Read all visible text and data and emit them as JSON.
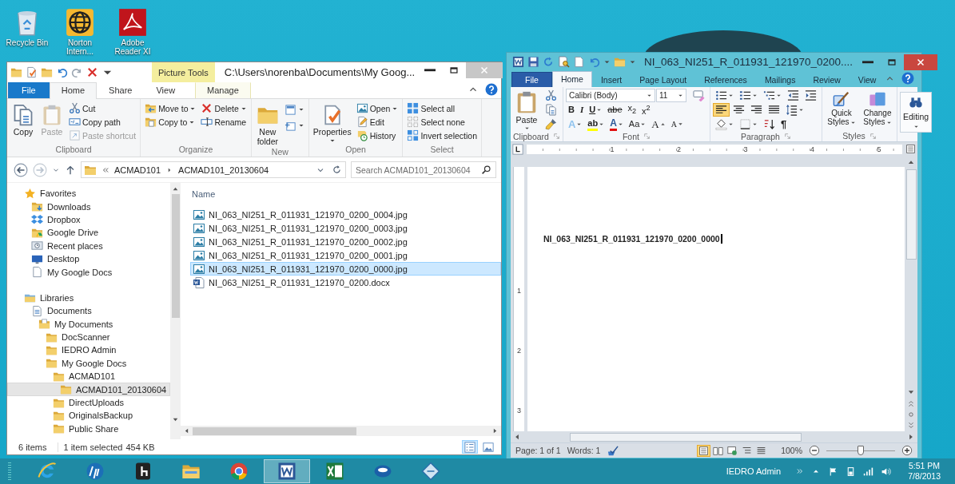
{
  "desktop_icons": [
    {
      "label": "Recycle Bin"
    },
    {
      "label": "Norton Intern..."
    },
    {
      "label": "Adobe Reader XI"
    }
  ],
  "explorer": {
    "title": "C:\\Users\\norenba\\Documents\\My Goog...",
    "tool_context": "Picture Tools",
    "tabs": [
      {
        "label": "File",
        "kind": "file",
        "selected": false
      },
      {
        "label": "Home",
        "kind": "tab",
        "selected": true
      },
      {
        "label": "Share",
        "kind": "tab",
        "selected": false
      },
      {
        "label": "View",
        "kind": "tab",
        "selected": false
      },
      {
        "label": "Manage",
        "kind": "tool",
        "selected": false
      }
    ],
    "ribbon_groups": [
      {
        "label": "Clipboard",
        "columns": [
          [
            {
              "label": "Copy",
              "kind": "large",
              "disabled": false,
              "dropdown": false
            }
          ],
          [
            {
              "label": "Paste",
              "kind": "large",
              "disabled": true,
              "dropdown": false
            }
          ],
          [
            {
              "label": "Cut",
              "kind": "small",
              "disabled": false,
              "dropdown": false
            },
            {
              "label": "Copy path",
              "kind": "small",
              "disabled": false,
              "dropdown": false
            },
            {
              "label": "Paste shortcut",
              "kind": "small",
              "disabled": true,
              "dropdown": false
            }
          ]
        ]
      },
      {
        "label": "Organize",
        "columns": [
          [
            {
              "label": "Move to",
              "kind": "small",
              "disabled": false,
              "dropdown": true
            },
            {
              "label": "Copy to",
              "kind": "small",
              "disabled": false,
              "dropdown": true
            }
          ],
          [
            {
              "label": "Delete",
              "kind": "small",
              "disabled": false,
              "dropdown": true
            },
            {
              "label": "Rename",
              "kind": "small",
              "disabled": false,
              "dropdown": false
            }
          ]
        ]
      },
      {
        "label": "New",
        "columns": [
          [
            {
              "label": "New folder",
              "kind": "large",
              "disabled": false,
              "dropdown": false
            }
          ],
          [
            {
              "kind": "icon",
              "disabled": false,
              "dropdown": true
            },
            {
              "kind": "icon",
              "disabled": false,
              "dropdown": true
            }
          ]
        ]
      },
      {
        "label": "Open",
        "columns": [
          [
            {
              "label": "Properties",
              "kind": "large",
              "disabled": false,
              "dropdown": true
            }
          ],
          [
            {
              "label": "Open",
              "kind": "small",
              "disabled": false,
              "dropdown": true
            },
            {
              "label": "Edit",
              "kind": "small",
              "disabled": false,
              "dropdown": false
            },
            {
              "label": "History",
              "kind": "small",
              "disabled": false,
              "dropdown": false
            }
          ]
        ]
      },
      {
        "label": "Select",
        "columns": [
          [
            {
              "label": "Select all",
              "kind": "small",
              "disabled": false,
              "dropdown": false
            },
            {
              "label": "Select none",
              "kind": "small",
              "disabled": false,
              "dropdown": false
            },
            {
              "label": "Invert selection",
              "kind": "small",
              "disabled": false,
              "dropdown": false
            }
          ]
        ]
      }
    ],
    "breadcrumb": [
      "ACMAD101",
      "ACMAD101_20130604"
    ],
    "search": {
      "placeholder": "Search ACMAD101_20130604"
    },
    "nav_tree": [
      {
        "label": "Favorites",
        "kind": "star",
        "selected": false,
        "children": [
          {
            "label": "Downloads",
            "kind": "downloads",
            "selected": false
          },
          {
            "label": "Dropbox",
            "kind": "dropbox",
            "selected": false
          },
          {
            "label": "Google Drive",
            "kind": "drive",
            "selected": false
          },
          {
            "label": "Recent places",
            "kind": "recent",
            "selected": false
          },
          {
            "label": "Desktop",
            "kind": "desktop",
            "selected": false
          },
          {
            "label": "My Google Docs",
            "kind": "page",
            "selected": false
          }
        ]
      },
      {
        "label": "Libraries",
        "kind": "library",
        "selected": false,
        "children": [
          {
            "label": "Documents",
            "kind": "doclib",
            "selected": false,
            "children": [
              {
                "label": "My Documents",
                "kind": "docfolder",
                "selected": false,
                "children": [
                  {
                    "label": "DocScanner",
                    "kind": "folder",
                    "selected": false
                  },
                  {
                    "label": "IEDRO Admin",
                    "kind": "folder",
                    "selected": false
                  },
                  {
                    "label": "My Google Docs",
                    "kind": "folder",
                    "selected": false,
                    "children": [
                      {
                        "label": "ACMAD101",
                        "kind": "folder",
                        "selected": false,
                        "children": [
                          {
                            "label": "ACMAD101_20130604",
                            "kind": "folder",
                            "selected": true
                          }
                        ]
                      },
                      {
                        "label": "DirectUploads",
                        "kind": "folder",
                        "selected": false
                      },
                      {
                        "label": "OriginalsBackup",
                        "kind": "folder",
                        "selected": false
                      },
                      {
                        "label": "Public Share",
                        "kind": "folder",
                        "selected": false
                      }
                    ]
                  }
                ]
              }
            ]
          }
        ]
      }
    ],
    "column_header": "Name",
    "files": [
      {
        "name": "NI_063_NI251_R_011931_121970_0200_0004.jpg",
        "kind": "image",
        "selected": false
      },
      {
        "name": "NI_063_NI251_R_011931_121970_0200_0003.jpg",
        "kind": "image",
        "selected": false
      },
      {
        "name": "NI_063_NI251_R_011931_121970_0200_0002.jpg",
        "kind": "image",
        "selected": false
      },
      {
        "name": "NI_063_NI251_R_011931_121970_0200_0001.jpg",
        "kind": "image",
        "selected": false
      },
      {
        "name": "NI_063_NI251_R_011931_121970_0200_0000.jpg",
        "kind": "image",
        "selected": true
      },
      {
        "name": "NI_063_NI251_R_011931_121970_0200.docx",
        "kind": "word",
        "selected": false
      }
    ],
    "status": {
      "count": "6 items",
      "selection": "1 item selected",
      "size": "454 KB"
    },
    "view_buttons": [
      {
        "selected": true
      },
      {
        "selected": false
      }
    ]
  },
  "word": {
    "title": "NI_063_NI251_R_011931_121970_0200....",
    "tabs": [
      {
        "label": "File",
        "kind": "file",
        "selected": false
      },
      {
        "label": "Home",
        "kind": "tab",
        "selected": true
      },
      {
        "label": "Insert",
        "kind": "tab",
        "selected": false
      },
      {
        "label": "Page Layout",
        "kind": "tab",
        "selected": false
      },
      {
        "label": "References",
        "kind": "tab",
        "selected": false
      },
      {
        "label": "Mailings",
        "kind": "tab",
        "selected": false
      },
      {
        "label": "Review",
        "kind": "tab",
        "selected": false
      },
      {
        "label": "View",
        "kind": "tab",
        "selected": false
      }
    ],
    "clipboard": {
      "paste": "Paste",
      "label": "Clipboard"
    },
    "font": {
      "label": "Font",
      "name": "Calibri (Body)",
      "size": "11",
      "format_buttons": [
        {
          "label": "B",
          "kind": "bold",
          "dropdown": false
        },
        {
          "label": "I",
          "kind": "italic",
          "dropdown": false
        },
        {
          "label": "U",
          "kind": "underline",
          "dropdown": true
        },
        {
          "label": "abe",
          "kind": "strike",
          "dropdown": false
        },
        {
          "label": "x$_{2}$",
          "kind": "plain",
          "dropdown": false
        },
        {
          "label": "x$^{2}$",
          "kind": "plain",
          "dropdown": false
        }
      ],
      "effect_buttons": [
        {
          "label": "A",
          "kind": "glow",
          "dropdown": true
        },
        {
          "label": "ab",
          "kind": "highlight",
          "color": "#ffff00",
          "dropdown": true
        },
        {
          "label": "A",
          "kind": "fontcolor",
          "color": "#e01010",
          "dropdown": true
        },
        {
          "label": "Aa",
          "kind": "plain",
          "dropdown": true
        },
        {
          "label": "A",
          "kind": "grow",
          "dropdown": false
        },
        {
          "label": "A",
          "kind": "shrink",
          "dropdown": false
        }
      ]
    },
    "paragraph": {
      "label": "Paragraph",
      "alignment": [
        {
          "selected": true
        },
        {
          "selected": false
        },
        {
          "selected": false
        },
        {
          "selected": false
        }
      ],
      "pilcrow": "¶"
    },
    "styles": {
      "label": "Styles",
      "buttons": [
        "Quick Styles",
        "Change Styles"
      ]
    },
    "editing": "Editing",
    "ruler_numbers": [
      "1",
      "2",
      "3",
      "4",
      "5"
    ],
    "vertical_ruler_numbers": [
      "1",
      "2",
      "3"
    ],
    "document_text": "NI_063_NI251_R_011931_121970_0200_0000",
    "status": {
      "page": "Page: 1 of 1",
      "words": "Words: 1",
      "zoom": "100%"
    },
    "view_buttons": [
      {
        "selected": true
      },
      {
        "selected": false
      },
      {
        "selected": false
      },
      {
        "selected": false
      },
      {
        "selected": false
      }
    ],
    "zoom_slider": {
      "level": 0.5
    }
  },
  "taskbar": {
    "apps": [
      {
        "selected": false
      },
      {
        "selected": false
      },
      {
        "selected": false
      },
      {
        "selected": false
      },
      {
        "selected": false
      },
      {
        "selected": true
      },
      {
        "selected": false
      },
      {
        "selected": false
      },
      {
        "selected": false
      }
    ],
    "user": "IEDRO Admin",
    "time": "5:51 PM",
    "date": "7/8/2013"
  }
}
